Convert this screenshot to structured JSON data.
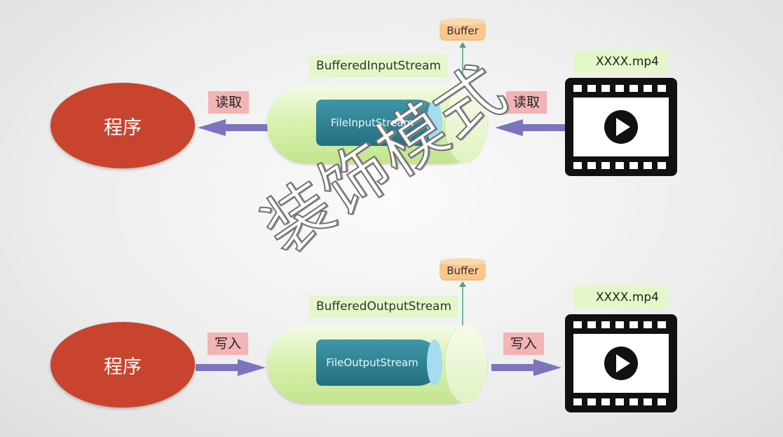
{
  "watermark": "装饰模式",
  "input_flow": {
    "program": "程序",
    "left_action": "读取",
    "right_action": "读取",
    "outer_stream": "BufferedInputStream",
    "inner_stream": "FileInputStream",
    "buffer": "Buffer",
    "file": "XXXX.mp4"
  },
  "output_flow": {
    "program": "程序",
    "left_action": "写入",
    "right_action": "写入",
    "outer_stream": "BufferedOutputStream",
    "inner_stream": "FileOutputStream",
    "buffer": "Buffer",
    "file": "XXXX.mp4"
  },
  "colors": {
    "program": "#c9442f",
    "arrow": "#7b74bf",
    "label_red": "#f2b4b4",
    "label_green": "#e4f7c8",
    "inner_stream": "#2e8193",
    "buffer": "#f9c78e"
  },
  "icons": [
    "film-video-icon",
    "play-icon"
  ]
}
